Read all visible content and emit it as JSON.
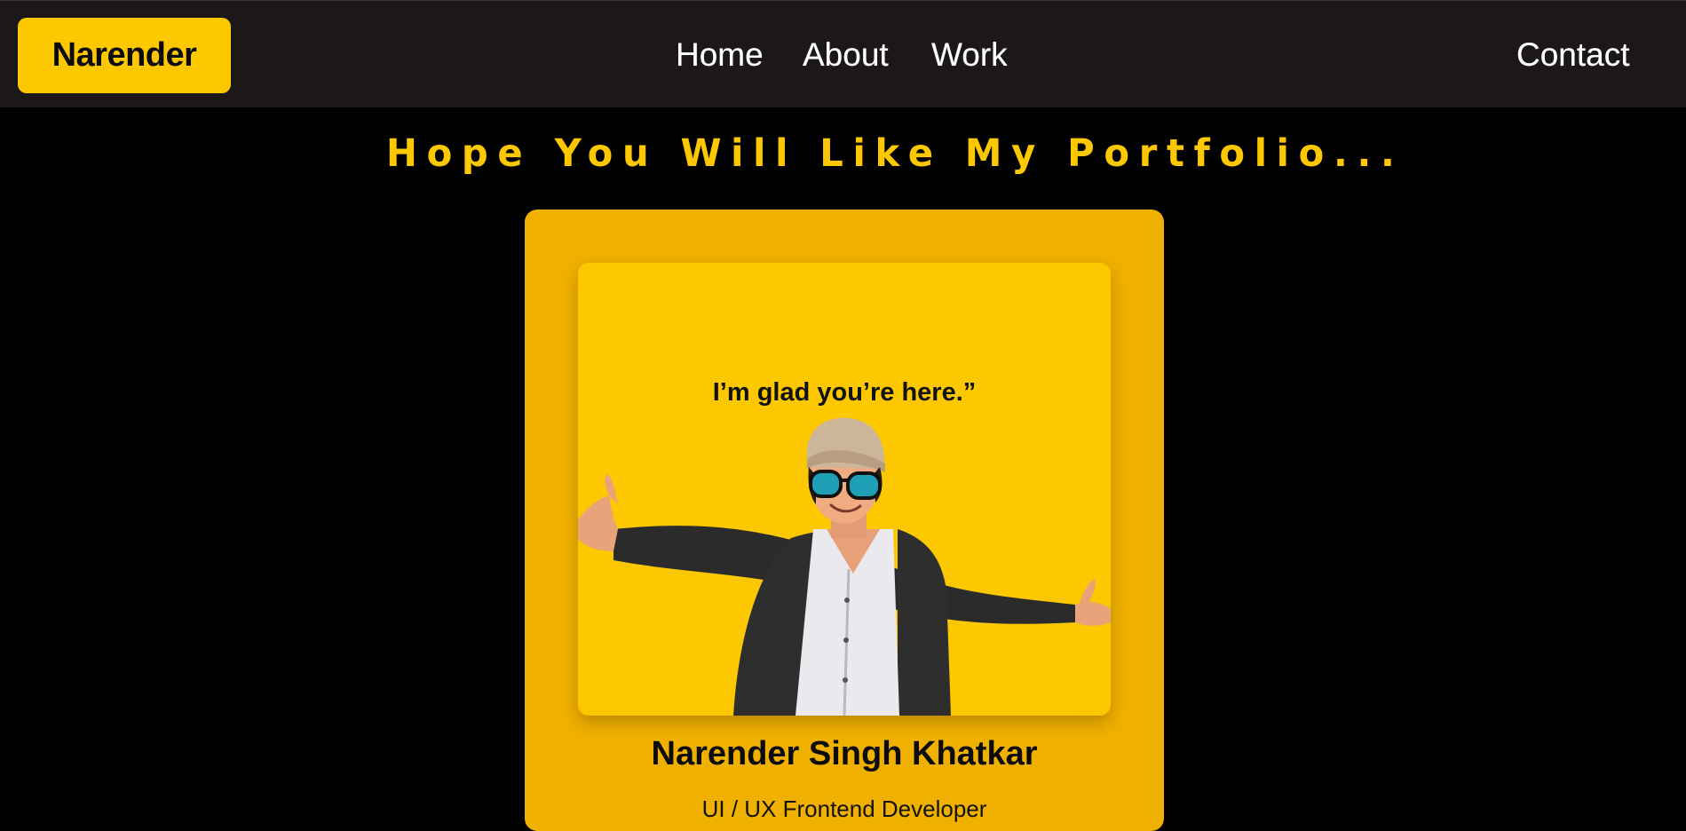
{
  "nav": {
    "brand": "Narender",
    "links": [
      "Home",
      "About",
      "Work"
    ],
    "contact": "Contact"
  },
  "hero": {
    "headline": "Hope You Will Like My Portfolio..."
  },
  "card": {
    "quote": "I’m glad you’re here.”",
    "name": "Narender Singh Khatkar",
    "role": "UI / UX Frontend Developer"
  },
  "colors": {
    "accent": "#fdc800",
    "card_bg": "#f0b000",
    "nav_bg": "#1b1817",
    "page_bg": "#000000"
  }
}
